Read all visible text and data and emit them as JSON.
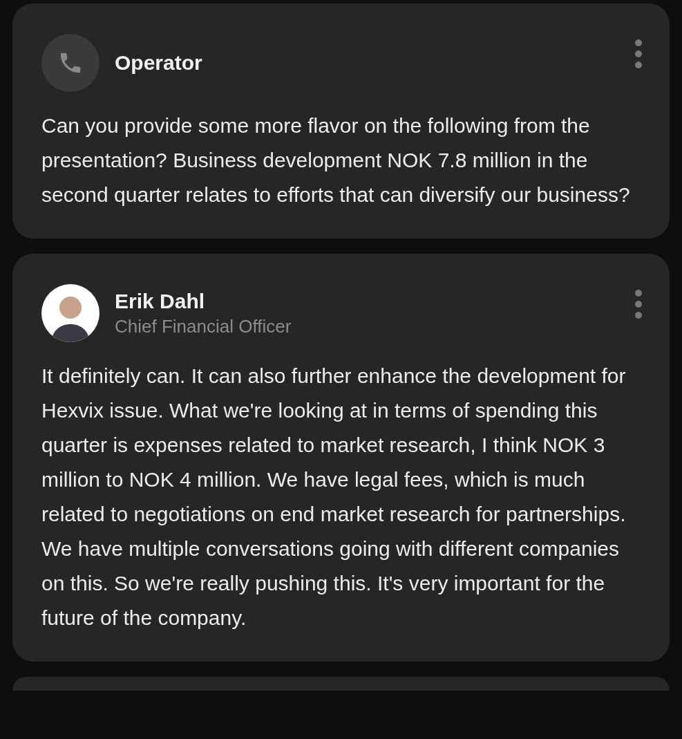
{
  "messages": [
    {
      "kind": "operator",
      "name": "Operator",
      "text": "Can you provide some more flavor on the following from the presentation? Business development NOK 7.8 million in the second quarter relates to efforts that can diversify our business?"
    },
    {
      "kind": "person",
      "name": "Erik Dahl",
      "title": "Chief Financial Officer",
      "text": "It definitely can. It can also further enhance the development for Hexvix issue. What we're looking at in terms of spending this quarter is expenses related to market research, I think NOK 3 million to NOK 4 million. We have legal fees, which is much related to negotiations on end market research for partnerships. We have multiple conversations going with different companies on this. So we're really pushing this. It's very important for the future of the company."
    }
  ]
}
